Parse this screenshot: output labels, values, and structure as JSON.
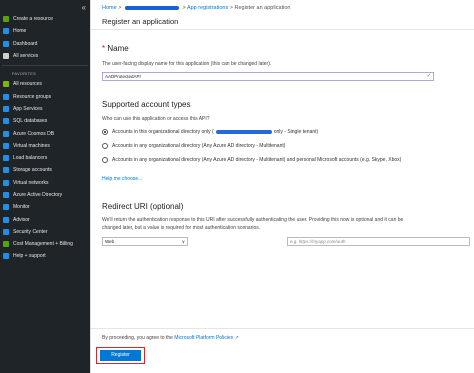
{
  "sidebar": {
    "collapse_glyph": "«",
    "items_top": [
      {
        "label": "Create a resource",
        "icon": "plus-icon",
        "color": "#57a300"
      },
      {
        "label": "Home",
        "icon": "home-icon",
        "color": "#1e90e8"
      },
      {
        "label": "Dashboard",
        "icon": "dashboard-icon",
        "color": "#1e90e8"
      },
      {
        "label": "All services",
        "icon": "list-icon",
        "color": "#cfcfcf"
      }
    ],
    "favorites_label": "FAVORITES",
    "items_fav": [
      {
        "label": "All resources",
        "icon": "grid-icon",
        "color": "#7cb900"
      },
      {
        "label": "Resource groups",
        "icon": "cube-icon",
        "color": "#1e90e8"
      },
      {
        "label": "App Services",
        "icon": "globe-icon",
        "color": "#1e90e8"
      },
      {
        "label": "SQL databases",
        "icon": "database-icon",
        "color": "#1e90e8"
      },
      {
        "label": "Azure Cosmos DB",
        "icon": "planet-icon",
        "color": "#1e90e8"
      },
      {
        "label": "Virtual machines",
        "icon": "monitor-icon",
        "color": "#1e90e8"
      },
      {
        "label": "Load balancers",
        "icon": "diamond-icon",
        "color": "#1e90e8"
      },
      {
        "label": "Storage accounts",
        "icon": "storage-icon",
        "color": "#1e90e8"
      },
      {
        "label": "Virtual networks",
        "icon": "network-icon",
        "color": "#1e90e8"
      },
      {
        "label": "Azure Active Directory",
        "icon": "triangle-icon",
        "color": "#1e90e8"
      },
      {
        "label": "Monitor",
        "icon": "gauge-icon",
        "color": "#1e90e8"
      },
      {
        "label": "Advisor",
        "icon": "advisor-icon",
        "color": "#1e90e8"
      },
      {
        "label": "Security Center",
        "icon": "shield-icon",
        "color": "#1e90e8"
      },
      {
        "label": "Cost Management + Billing",
        "icon": "billing-icon",
        "color": "#57a300"
      },
      {
        "label": "Help + support",
        "icon": "help-icon",
        "color": "#1e90e8"
      }
    ]
  },
  "breadcrumb": {
    "home": "Home",
    "sep": ">",
    "app_registrations": "App registrations",
    "current": "Register an application"
  },
  "page": {
    "title": "Register an application",
    "name_section": {
      "required_mark": "*",
      "heading": "Name",
      "description": "The user-facing display name for this application (this can be changed later).",
      "value": "AADProtectedAPI",
      "valid_glyph": "✓"
    },
    "account_types": {
      "heading": "Supported account types",
      "question": "Who can use this application or access this API?",
      "option1_prefix": "Accounts in this organizational directory only (",
      "option1_suffix": "only - Single tenant)",
      "option2": "Accounts in any organizational directory (Any Azure AD directory - Multitenant)",
      "option3": "Accounts in any organizational directory (Any Azure AD directory - Multitenant) and personal Microsoft accounts (e.g. Skype, Xbox)",
      "help_link": "Help me choose..."
    },
    "redirect": {
      "heading": "Redirect URI (optional)",
      "description_line1": "We'll return the authentication response to this URI after successfully authenticating the user. Providing this now is optional and it can be",
      "description_line2": "changed later, but a value is required for most authentication scenarios.",
      "platform_value": "Web",
      "platform_chevron": "∨",
      "uri_placeholder": "e.g. https://myapp.com/auth"
    },
    "footer": {
      "policy_prefix": "By proceeding, you agree to the ",
      "policy_link": "Microsoft Platform Policies",
      "policy_icon": "↗",
      "register_label": "Register"
    }
  }
}
